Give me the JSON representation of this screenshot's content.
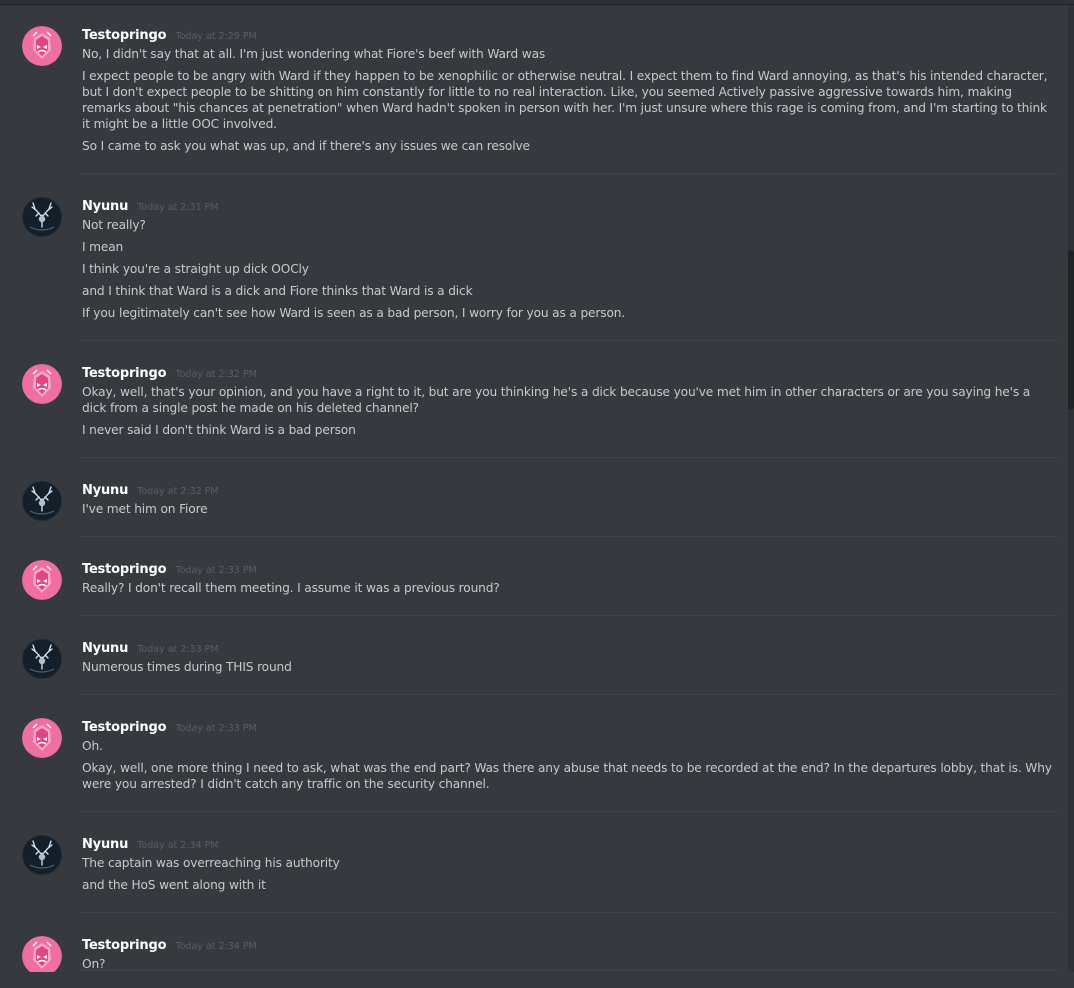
{
  "colors": {
    "background": "#36393e",
    "username": "#ffffff",
    "timestamp": "#5b5e63",
    "message_text": "#c8c9cb",
    "testo_avatar_bg": "#ef6fa3",
    "nyunu_avatar_bg": "#151f2a"
  },
  "groups": [
    {
      "author": "Testopringo",
      "avatar_icon": "pink-gem-avatar-icon",
      "timestamp": "Today at 2:29 PM",
      "messages": [
        "No, I didn't say that at all. I'm just wondering what Fiore's beef with Ward was",
        "I expect people to be angry with Ward if they happen to be xenophilic or otherwise neutral. I expect them to find Ward annoying, as that's his intended character, but I don't expect people to be shitting on him constantly  for little to no real interaction. Like, you seemed Actively passive aggressive towards him, making remarks about \"his chances at penetration\" when Ward hadn't spoken in person with her. I'm just unsure where this rage is coming from, and I'm starting to think it might be a little OOC involved.",
        "So I came to ask you what was up, and if there's any issues we can resolve"
      ]
    },
    {
      "author": "Nyunu",
      "avatar_icon": "dark-antler-avatar-icon",
      "timestamp": "Today at 2:31 PM",
      "messages": [
        "Not really?",
        "I mean",
        "I think you're a straight up dick OOCly",
        "and I think that Ward is a dick and Fiore thinks that Ward is a dick",
        "If you legitimately can't see how Ward is seen as a bad person, I worry for you as a person."
      ]
    },
    {
      "author": "Testopringo",
      "avatar_icon": "pink-gem-avatar-icon",
      "timestamp": "Today at 2:32 PM",
      "messages": [
        "Okay, well, that's your opinion, and you have a right to it, but are you thinking he's a dick because you've met him in other characters or are you saying he's a dick from a single post he made on his deleted channel?",
        "I never said I don't think Ward is a bad person"
      ]
    },
    {
      "author": "Nyunu",
      "avatar_icon": "dark-antler-avatar-icon",
      "timestamp": "Today at 2:32 PM",
      "messages": [
        "I've met him on Fiore"
      ]
    },
    {
      "author": "Testopringo",
      "avatar_icon": "pink-gem-avatar-icon",
      "timestamp": "Today at 2:33 PM",
      "messages": [
        "Really? I don't recall them meeting. I assume it was a previous round?"
      ]
    },
    {
      "author": "Nyunu",
      "avatar_icon": "dark-antler-avatar-icon",
      "timestamp": "Today at 2:33 PM",
      "messages": [
        "Numerous times during THIS round"
      ]
    },
    {
      "author": "Testopringo",
      "avatar_icon": "pink-gem-avatar-icon",
      "timestamp": "Today at 2:33 PM",
      "messages": [
        "Oh.",
        "Okay, well, one more thing I need to ask, what was the end part? Was there any abuse that needs to be recorded at the end? In the departures lobby, that is. Why were you arrested? I didn't catch any traffic on the security channel."
      ]
    },
    {
      "author": "Nyunu",
      "avatar_icon": "dark-antler-avatar-icon",
      "timestamp": "Today at 2:34 PM",
      "messages": [
        "The captain was overreaching his authority",
        "and the HoS went along with it"
      ]
    },
    {
      "author": "Testopringo",
      "avatar_icon": "pink-gem-avatar-icon",
      "timestamp": "Today at 2:34 PM",
      "messages": [
        "On?"
      ]
    }
  ]
}
